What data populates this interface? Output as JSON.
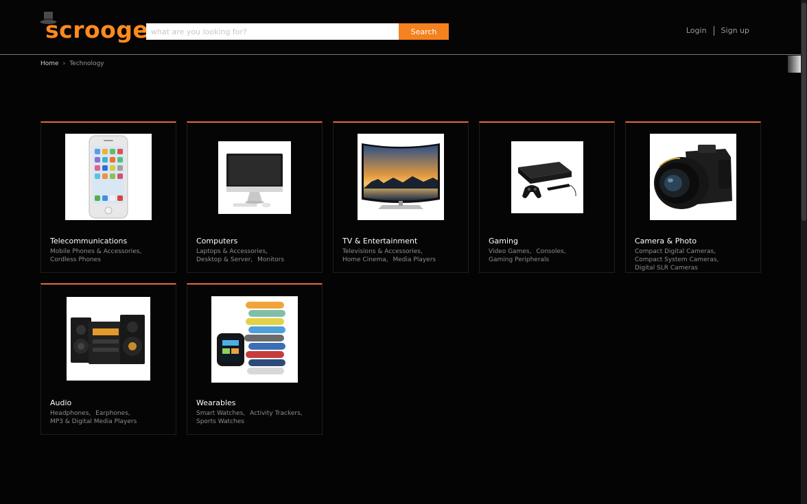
{
  "header": {
    "logo_text": "scrooge",
    "search": {
      "placeholder": "what are you looking for?",
      "button_label": "Search"
    },
    "login_label": "Login",
    "signup_label": "Sign up"
  },
  "breadcrumb": {
    "home": "Home",
    "current": "Technology"
  },
  "colors": {
    "accent": "#f5821f",
    "card_border": "#e76a3c",
    "background": "#040404"
  },
  "categories": [
    {
      "title": "Telecommunications",
      "image": "iphone-image",
      "subs": [
        "Mobile Phones & Accessories",
        "Cordless Phones"
      ]
    },
    {
      "title": "Computers",
      "image": "imac-image",
      "subs": [
        "Laptops & Accessories",
        "Desktop & Server",
        "Monitors"
      ]
    },
    {
      "title": "TV & Entertainment",
      "image": "curved-tv-image",
      "subs": [
        "Televisions & Accessories",
        "Home Cinema",
        "Media Players"
      ]
    },
    {
      "title": "Gaming",
      "image": "game-console-image",
      "subs": [
        "Video Games",
        "Consoles",
        "Gaming Peripherals"
      ]
    },
    {
      "title": "Camera & Photo",
      "image": "dslr-camera-image",
      "subs": [
        "Compact Digital Cameras",
        "Compact System Cameras",
        "Digital SLR Cameras"
      ]
    },
    {
      "title": "Audio",
      "image": "hifi-system-image",
      "subs": [
        "Headphones",
        "Earphones",
        "MP3 & Digital Media Players"
      ]
    },
    {
      "title": "Wearables",
      "image": "wearables-image",
      "subs": [
        "Smart Watches",
        "Activity Trackers",
        "Sports Watches"
      ]
    }
  ]
}
